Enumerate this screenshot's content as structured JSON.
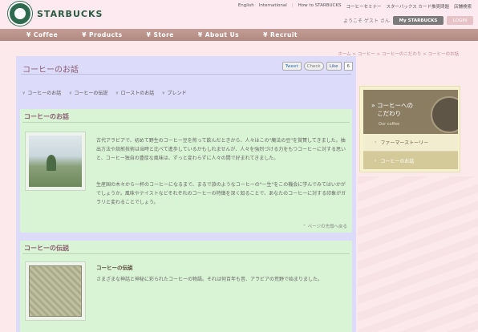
{
  "brand": "STARBUCKS",
  "top_links": [
    "English",
    "International",
    "How to STARBUCKS",
    "コーヒーセミナー",
    "スターバックス カード推奨問題",
    "店舗検索"
  ],
  "welcome": "ようこそ ゲスト さん",
  "my_button": "My STARBUCKS",
  "login_button": "LOGIN",
  "nav": [
    "Coffee",
    "Products",
    "Store",
    "About Us",
    "Recruit"
  ],
  "breadcrumb": "ホーム > コーヒー > コーヒーのこだわり > コーヒーのお話",
  "page_title": "コーヒーのお話",
  "share": {
    "tweet": "Tweet",
    "check": "Check",
    "like": "Like",
    "like_count": "6"
  },
  "anchors": [
    "コーヒーのお話",
    "コーヒーの伝説",
    "ローストのお話",
    "ブレンド"
  ],
  "section1": {
    "title": "コーヒーのお話",
    "para1": "古代アラビアで、初めて野生のコーヒー豆を煎って飲んだときから、人々はこの\"魔法の豆\"を賞賛してきました。抽出方法や焙煎技術は当時と比べて進歩しているかもしれませんが、人々を強烈づける力をもつコーヒーに対する思いと、コーヒー独自の豊厚な風味は、ずっと変わらずに人々の間で好まれてきました。",
    "para2": "生産国の木々から一杯のコーヒーになるまで、まるで旅のようなコーヒーの\"一生\"をこの機会に学んでみてはいかがでしょうか。風味やテイストなどそれぞれのコーヒーの特徴を深く知ることで、あなたのコーヒーに対する印象がガラリと変わることでしょう。",
    "pagetop": "ページの先頭へ戻る"
  },
  "section2": {
    "title": "コーヒーの伝説",
    "subtitle": "コーヒーの伝説",
    "text": "さまざまな神話と神秘に彩られたコーヒーの物語。それは何百年も昔、アラビアの荒野で始まりました。"
  },
  "side": {
    "title_line1": "コーヒーへの",
    "title_line2": "こだわり",
    "subtitle": "Our coffee",
    "items": [
      "ファーマーストーリー",
      "コーヒーのお話"
    ]
  }
}
